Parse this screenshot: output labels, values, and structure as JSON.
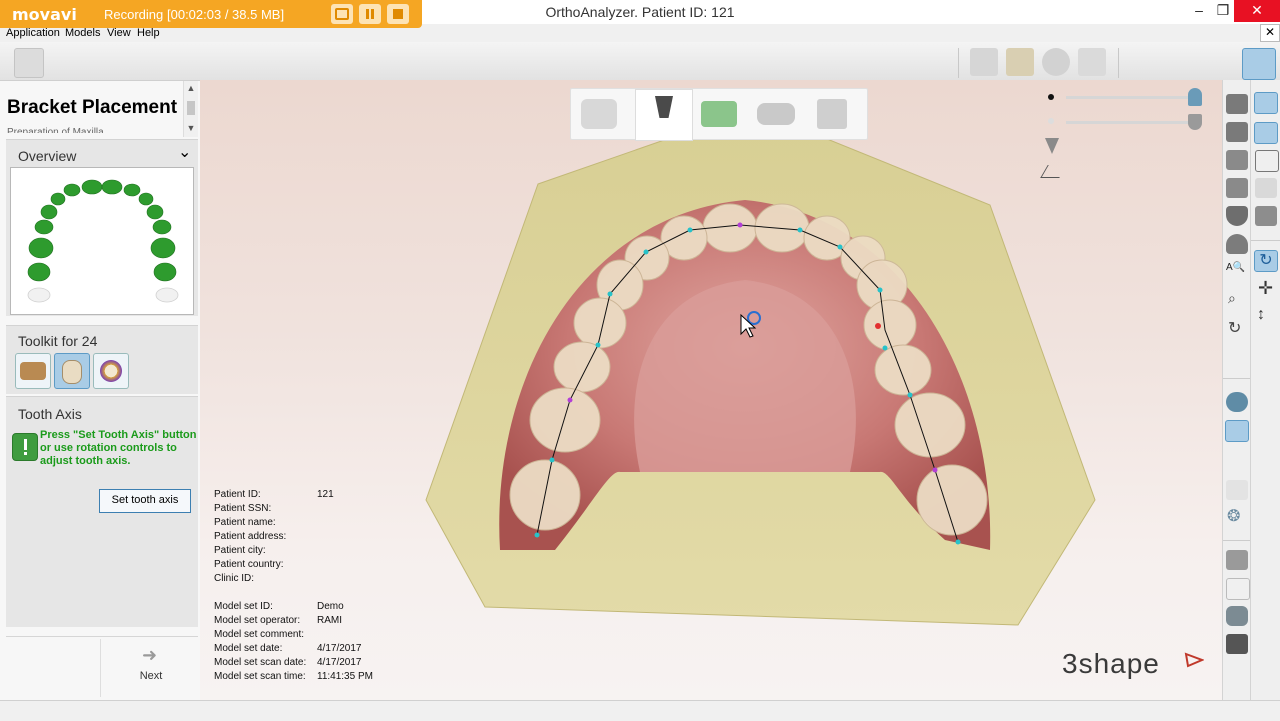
{
  "window": {
    "title": "OrthoAnalyzer. Patient ID: 121",
    "minimize_glyph": "–",
    "restore_glyph": "❐",
    "close_glyph": "✕"
  },
  "recorder": {
    "logo": "movavi",
    "status": "Recording",
    "time": "[00:02:03 / 38.5 MB]"
  },
  "menu": {
    "items": [
      "Application",
      "Models",
      "View",
      "Help"
    ],
    "close_glyph": "✕"
  },
  "panel": {
    "title": "Bracket Placement",
    "subtitle": "Preparation of Maxilla",
    "overview_label": "Overview",
    "chevron": "⌄",
    "toolkit_label": "Toolkit for 24",
    "tooth_axis_label": "Tooth Axis",
    "tooth_axis_message": "Press \"Set Tooth Axis\" button or use rotation controls to adjust tooth axis.",
    "set_axis_button": "Set tooth axis",
    "next_label": "Next",
    "next_arrow": "➜"
  },
  "info": {
    "patient": [
      {
        "label": "Patient ID:",
        "value": "121"
      },
      {
        "label": "Patient SSN:",
        "value": ""
      },
      {
        "label": "Patient name:",
        "value": ""
      },
      {
        "label": "Patient address:",
        "value": ""
      },
      {
        "label": "Patient city:",
        "value": ""
      },
      {
        "label": "Patient country:",
        "value": ""
      },
      {
        "label": "Clinic ID:",
        "value": ""
      }
    ],
    "model": [
      {
        "label": "Model set ID:",
        "value": "Demo"
      },
      {
        "label": "Model set operator:",
        "value": "RAMI"
      },
      {
        "label": "Model set comment:",
        "value": ""
      },
      {
        "label": "Model set date:",
        "value": "4/17/2017"
      },
      {
        "label": "Model set scan date:",
        "value": "4/17/2017"
      },
      {
        "label": "Model set scan time:",
        "value": "11:41:35 PM"
      }
    ]
  },
  "brand": "3shape",
  "colors": {
    "recorder": "#f5a623",
    "tooth_green": "#2e9b2e",
    "axis_line": "#111111",
    "point_cyan": "#27c2c9",
    "point_magenta": "#b23fd6",
    "point_red": "#e23030",
    "selection": "#a9cce6"
  }
}
